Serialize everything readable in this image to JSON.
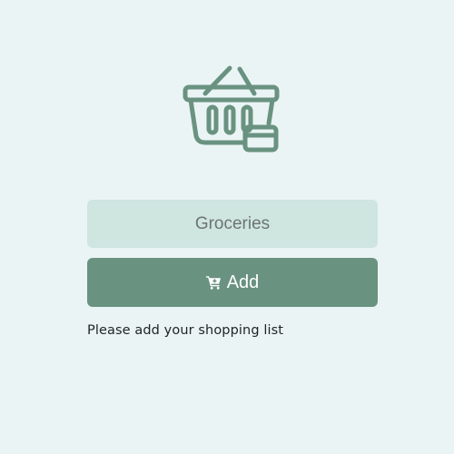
{
  "logo": {
    "icon": "shopping-basket-icon",
    "color": "#6a9280"
  },
  "item_input": {
    "value": "",
    "placeholder": "Groceries"
  },
  "add_button": {
    "icon": "cart-plus-icon",
    "label": "Add"
  },
  "hint": {
    "text": "Please add your shopping list"
  },
  "colors": {
    "background": "#eaf4f5",
    "input_background": "#cee5e0",
    "accent": "#6a9280",
    "text": "#1f2322"
  }
}
